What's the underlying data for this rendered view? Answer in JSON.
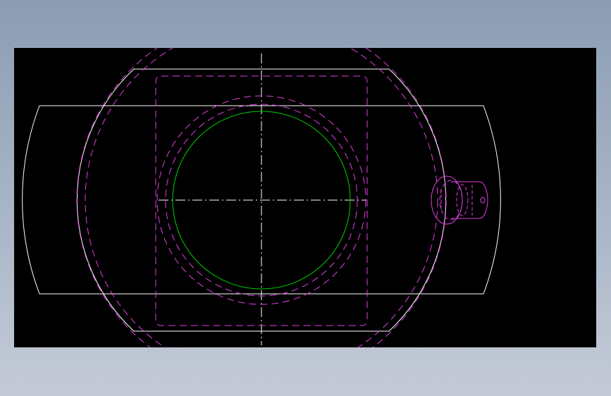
{
  "drawing": {
    "background_color": "#000000",
    "page_background_color": "#9aa9bc",
    "colors": {
      "outline": "#ffffff",
      "hidden": "#e040e0",
      "bore": "#00d000",
      "centerline": "#ffffff"
    }
  }
}
